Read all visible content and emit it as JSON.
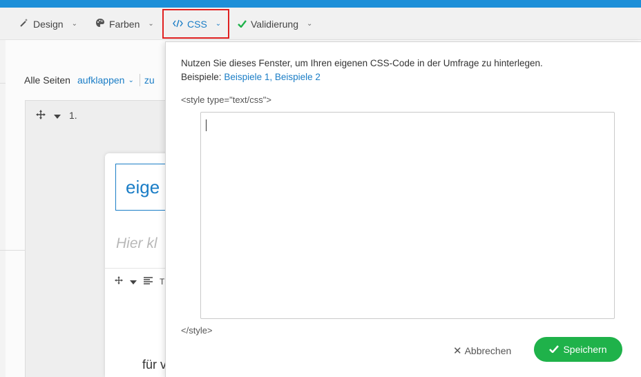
{
  "menubar": {
    "items": [
      {
        "label": "Design",
        "icon": "magic-wand-icon"
      },
      {
        "label": "Farben",
        "icon": "palette-icon"
      },
      {
        "label": "CSS",
        "icon": "code-icon"
      },
      {
        "label": "Validierung",
        "icon": "check-icon"
      }
    ]
  },
  "pages_bar": {
    "label": "Alle Seiten",
    "expand": "aufklappen",
    "more": "zu"
  },
  "page": {
    "number": "1.",
    "title_fragment": "eige",
    "hint_fragment": "Hier kl",
    "question_fragment": "T",
    "body_fragment": "für v"
  },
  "css_popup": {
    "description_line1": "Nutzen Sie dieses Fenster, um Ihren eigenen CSS-Code in der Umfrage zu hinterlegen.",
    "examples_label": "Beispiele:",
    "example1": "Beispiele 1",
    "example_sep": ", ",
    "example2": "Beispiele 2",
    "style_open": "<style type=\"text/css\">",
    "css_value": "",
    "style_close": "</style>",
    "cancel_label": "Abbrechen",
    "save_label": "Speichern"
  },
  "colors": {
    "accent": "#1a7dc6",
    "save": "#1fb24a",
    "highlight": "#e02020",
    "top_strip": "#1d8fd8"
  }
}
